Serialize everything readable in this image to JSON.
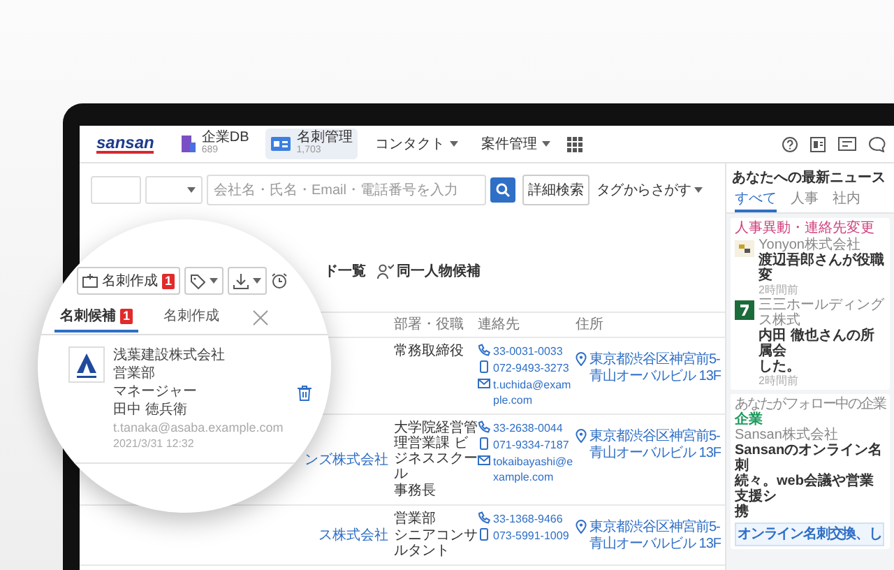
{
  "header": {
    "logo": "sansan",
    "nav": [
      {
        "kind": "app",
        "label": "企業DB",
        "count": "689",
        "selected": false
      },
      {
        "kind": "app",
        "label": "名刺管理",
        "count": "1,703",
        "selected": true
      },
      {
        "kind": "menu",
        "label": "コンタクト",
        "selected": false
      },
      {
        "kind": "menu",
        "label": "案件管理",
        "selected": false
      }
    ]
  },
  "search": {
    "placeholder": "会社名・氏名・Email・電話番号を入力",
    "detail_button": "詳細検索",
    "tag_menu": "タグからさがす"
  },
  "toolbar": [
    "ド一覧",
    "同一人物候補"
  ],
  "table": {
    "columns": [
      "部署・役職",
      "連絡先",
      "住所"
    ],
    "rows": [
      {
        "title": "常務取締役",
        "phone": "33-0031-0033",
        "mobile": "072-9493-3273",
        "email": "t.uchida@example.com",
        "address": [
          "東京都渋谷区神宮前5-",
          "青山オーバルビル 13F"
        ]
      },
      {
        "company": "ンズ株式会社",
        "department": "大学院経営管理営業課 ビジネススクール",
        "title": "事務長",
        "phone": "33-2638-0044",
        "mobile": "071-9334-7187",
        "email": "tokaibayashi@example.com",
        "address": [
          "東京都渋谷区神宮前5-",
          "青山オーバルビル 13F"
        ]
      },
      {
        "company": "ス株式会社",
        "department": "営業部",
        "title": "シニアコンサルタント",
        "phone": "33-1368-9466",
        "mobile": "073-5991-1009",
        "address": [
          "東京都渋谷区神宮前5-",
          "青山オーバルビル 13F"
        ]
      }
    ]
  },
  "news": {
    "title": "あなたへの最新ニュース",
    "tabs": [
      {
        "label": "すべて",
        "selected": true
      },
      {
        "label": "人事",
        "selected": false
      },
      {
        "label": "社内",
        "selected": false
      }
    ],
    "updates": {
      "label": "人事異動・連絡先変更",
      "items": [
        {
          "company": "Yonyon株式会社",
          "headline": [
            "渡辺吾郎さんが役職変"
          ],
          "time": "2時間前"
        },
        {
          "company": "三三ホールディングス株式",
          "headline": [
            "内田 徹也さんの所属会",
            "した。"
          ],
          "time": "2時間前"
        }
      ]
    },
    "follow": {
      "label": "あなたがフォロー中の企業",
      "tag": "企業",
      "company": "Sansan株式会社",
      "headline": [
        "Sansanのオンライン名刺",
        "続々。web会議や営業支援シ",
        "携"
      ],
      "banner": "オンライン名刺交換、し"
    }
  },
  "lens": {
    "create_button": "名刺作成",
    "create_badge": "1",
    "tabs": [
      {
        "label": "名刺候補",
        "badge": "1",
        "selected": true
      },
      {
        "label": "名刺作成",
        "selected": false
      }
    ],
    "candidate": {
      "company": "浅葉建設株式会社",
      "department": "営業部",
      "title": "マネージャー",
      "name": "田中 徳兵衛",
      "email": "t.tanaka@asaba.example.com",
      "date": "2021/3/31 12:32"
    }
  }
}
